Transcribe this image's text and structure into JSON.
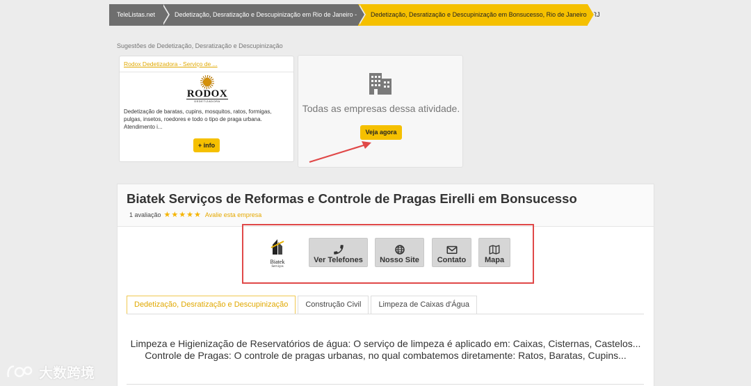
{
  "breadcrumb": [
    "TeleListas.net",
    "Dedetização, Desratização e Descupinização em Rio de Janeiro - RJ",
    "Dedetização, Desratização e Descupinização em Bonsucesso, Rio de Janeiro - RJ"
  ],
  "suggestions": {
    "title": "Sugestões de Dedetização, Desratização e Descupinização",
    "card": {
      "link": "Rodox Dedetizadora - Serviço de ...",
      "logo_text": "RODOX",
      "logo_sub": "DEDETIZADORA",
      "description": "Dedetização de baratas, cupins, mosquitos, ratos, formigas, pulgas, insetos, roedores e todo o tipo de praga urbana. Atendimento i...",
      "button": "+ info"
    },
    "all_card": {
      "icon": "building-icon",
      "text": "Todas as empresas dessa atividade.",
      "button": "Veja agora"
    }
  },
  "company": {
    "name": "Biatek Serviços de Reformas e Controle de Pragas Eirelli em Bonsucesso",
    "reviews": "1 avaliação",
    "stars": "★★★★★",
    "rating": 5,
    "rate_link": "Avalie esta empresa",
    "logo_name": "Biatek",
    "logo_sub": "Serviços",
    "actions": [
      {
        "icon": "phone-icon",
        "label": "Ver Telefones"
      },
      {
        "icon": "globe-icon",
        "label": "Nosso Site"
      },
      {
        "icon": "envelope-icon",
        "label": "Contato"
      },
      {
        "icon": "map-icon",
        "label": "Mapa"
      }
    ],
    "tabs": [
      "Dedetização, Desratização e Descupinização",
      "Construção Civil",
      "Limpeza de Caixas d'Água"
    ],
    "description_lines": [
      "Limpeza e Higienização de Reservatórios de água: O serviço de limpeza é aplicado em: Caixas, Cisternas, Castelos...",
      "Controle de Pragas: O controle de pragas urbanas, no qual combatemos diretamente: Ratos, Baratas, Cupins..."
    ]
  },
  "watermark": "大数跨境",
  "colors": {
    "accent": "#f5c000",
    "crumb_gray": "#6e6e6e",
    "highlight_red": "#e04848"
  }
}
